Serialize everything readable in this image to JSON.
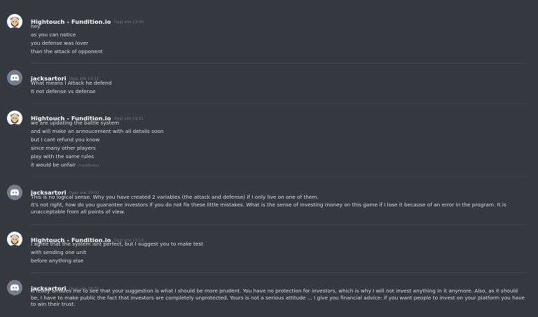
{
  "messages": [
    {
      "author": "Hightouch - Fundition.io",
      "timestamp": "Oggi alle 19:00",
      "avatar": "avatar-bearded-man",
      "lines": [
        "hey",
        "as you can notice",
        "you defense was lover",
        "than the attack of opponent"
      ]
    },
    {
      "author": "jacksartori",
      "timestamp": "Oggi alle 19:01",
      "avatar": "discord-default-avatar",
      "lines": [
        "What means I Attack he defend",
        "It not defense vs defense"
      ]
    },
    {
      "author": "Hightouch - Fundition.io",
      "timestamp": "Oggi alle 19:01",
      "avatar": "avatar-bearded-man",
      "lines": [
        "we are updating the battle system",
        "and will make an annoucement with all details soon",
        "but I cant refund you know",
        "since many other players",
        "play with the same rules",
        "it would be unfair"
      ],
      "edited": "(modificato)"
    },
    {
      "author": "jacksartori",
      "timestamp": "Oggi alle 19:02",
      "avatar": "discord-default-avatar",
      "lines": [
        "This is no logical sense. Why you have created 2 variables (the attack and defense) if I only live on one of them.",
        "It's not right, how do you guarantee investors if you do not fix these little mistakes. What is the sense of investing money on this game if I lose it because of an error in the program. It is unacceptable from all points of view."
      ]
    },
    {
      "author": "Hightouch - Fundition.io",
      "timestamp": "Oggi alle 19:10",
      "avatar": "avatar-bearded-man",
      "lines": [
        "I agree that the system isnt perfect, but I suggest you to make test",
        "with sending one unit",
        "before anything else"
      ]
    },
    {
      "author": "jacksartori",
      "timestamp": "Oggi alle 19:20",
      "avatar": "discord-default-avatar",
      "lines": [
        "It really amazes me to see that your suggestion is what I should be more prudent. You have no protection for investors, which is why I will not invest anything in it anymore. Also, as it should be, I have to make public the fact that investors are completely unprotected. Yours is not a serious attitude ... I give you financial advice: if you want people to invest on your platform you have to win their trust."
      ]
    }
  ],
  "colors": {
    "background": "#36393f",
    "author": "#ffffff",
    "text": "#dcddde",
    "timestamp": "#72767d",
    "discord_avatar_bg": "#747f8d"
  }
}
